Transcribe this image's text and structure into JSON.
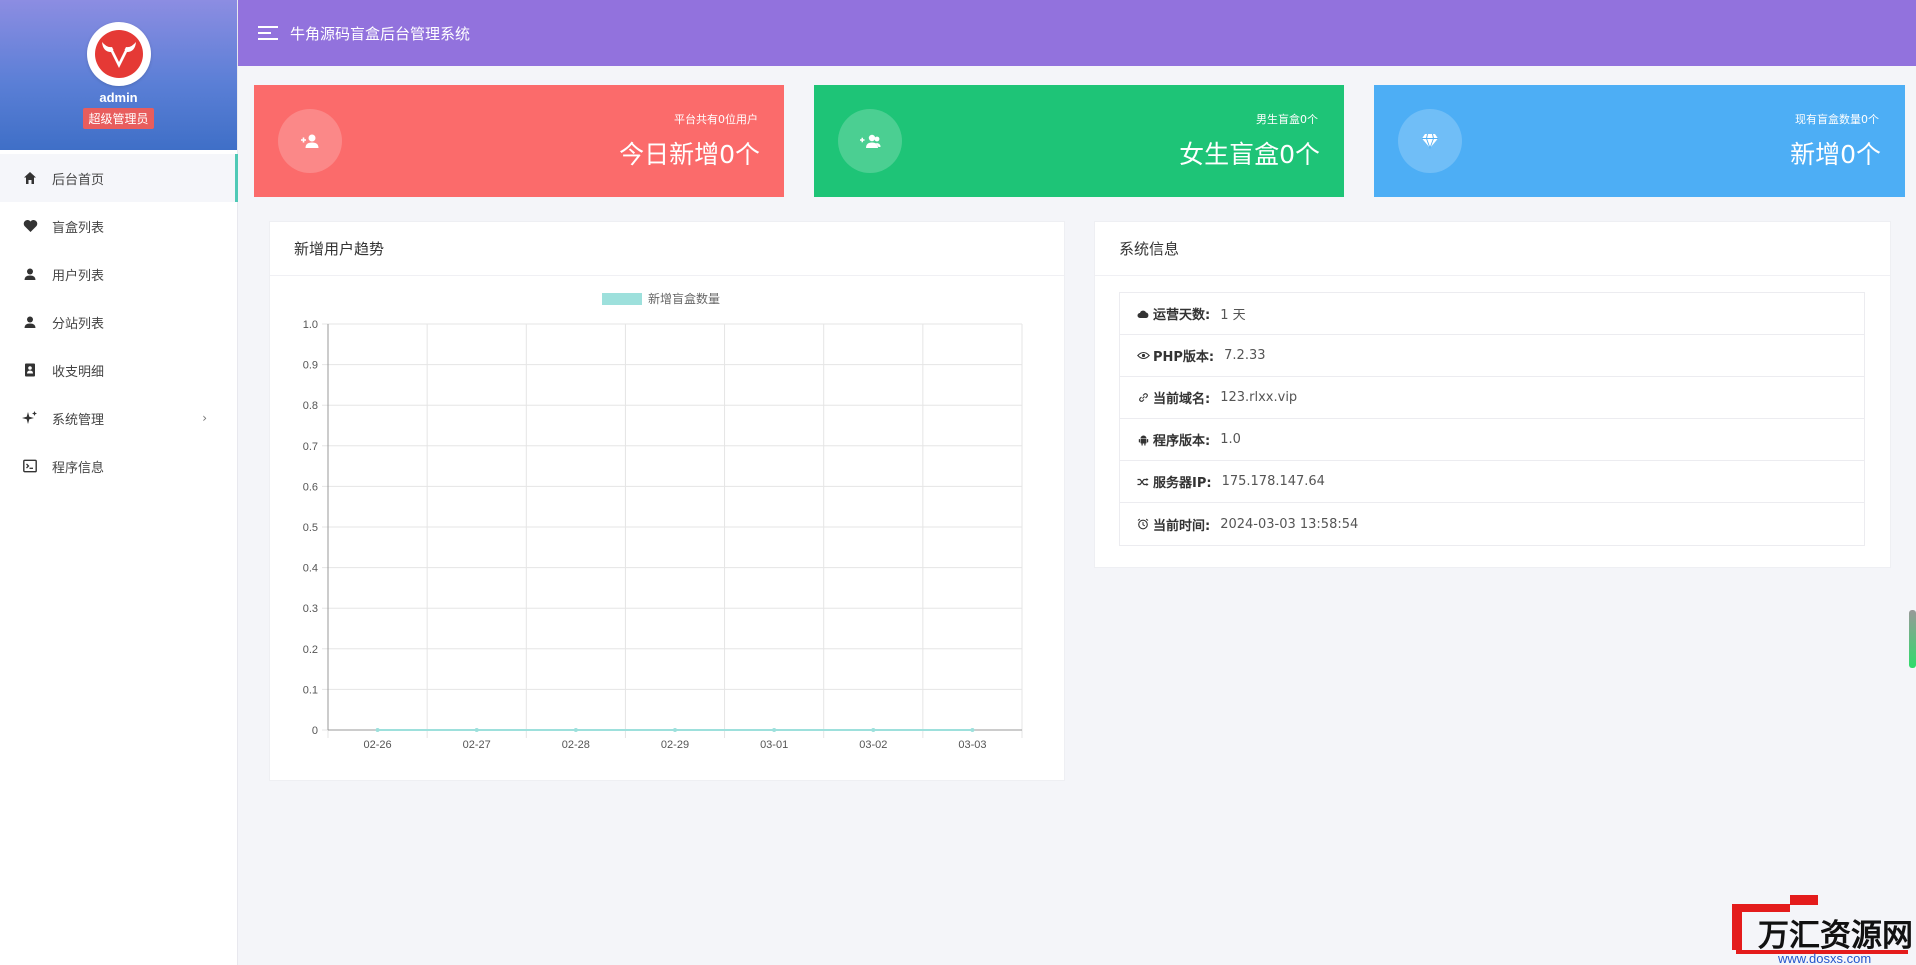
{
  "topbar": {
    "title": "牛角源码盲盒后台管理系统"
  },
  "sidebar": {
    "username": "admin",
    "role": "超级管理员",
    "items": [
      {
        "label": "后台首页",
        "icon": "home-icon"
      },
      {
        "label": "盲盒列表",
        "icon": "heart-icon"
      },
      {
        "label": "用户列表",
        "icon": "user-icon"
      },
      {
        "label": "分站列表",
        "icon": "user-icon"
      },
      {
        "label": "收支明细",
        "icon": "contact-book-icon"
      },
      {
        "label": "系统管理",
        "icon": "sparkle-icon"
      },
      {
        "label": "程序信息",
        "icon": "terminal-icon"
      }
    ]
  },
  "stats": [
    {
      "small": "平台共有0位用户",
      "big": "今日新增0个",
      "icon": "user-plus-icon",
      "color": "#fb6b6b"
    },
    {
      "small": "男生盲盒0个",
      "big": "女生盲盒0个",
      "icon": "users-icon",
      "color": "#1ec477"
    },
    {
      "small": "现有盲盒数量0个",
      "big": "新增0个",
      "icon": "diamond-icon",
      "color": "#4daef5"
    }
  ],
  "chart_panel": {
    "title": "新增用户趋势"
  },
  "chart_data": {
    "type": "line",
    "categories": [
      "02-26",
      "02-27",
      "02-28",
      "02-29",
      "03-01",
      "03-02",
      "03-03"
    ],
    "series": [
      {
        "name": "新增盲盒数量",
        "values": [
          0,
          0,
          0,
          0,
          0,
          0,
          0
        ],
        "color": "#9de0dc"
      }
    ],
    "yticks": [
      "1.0",
      "0.9",
      "0.8",
      "0.7",
      "0.6",
      "0.5",
      "0.4",
      "0.3",
      "0.2",
      "0.1",
      "0"
    ],
    "ylim": [
      0,
      1
    ],
    "grid": true,
    "legend": "top"
  },
  "info_panel": {
    "title": "系统信息",
    "rows": [
      {
        "key": "运营天数:",
        "value": "1 天",
        "icon": "cloud-icon"
      },
      {
        "key": "PHP版本:",
        "value": "7.2.33",
        "icon": "eye-icon"
      },
      {
        "key": "当前域名:",
        "value": "123.rlxx.vip",
        "icon": "link-icon"
      },
      {
        "key": "程序版本:",
        "value": "1.0",
        "icon": "android-icon"
      },
      {
        "key": "服务器IP:",
        "value": "175.178.147.64",
        "icon": "shuffle-icon"
      },
      {
        "key": "当前时间:",
        "value": "2024-03-03 13:58:54",
        "icon": "alarm-icon"
      }
    ]
  },
  "watermark": {
    "name": "万汇资源网",
    "url": "www.dosxs.com"
  }
}
